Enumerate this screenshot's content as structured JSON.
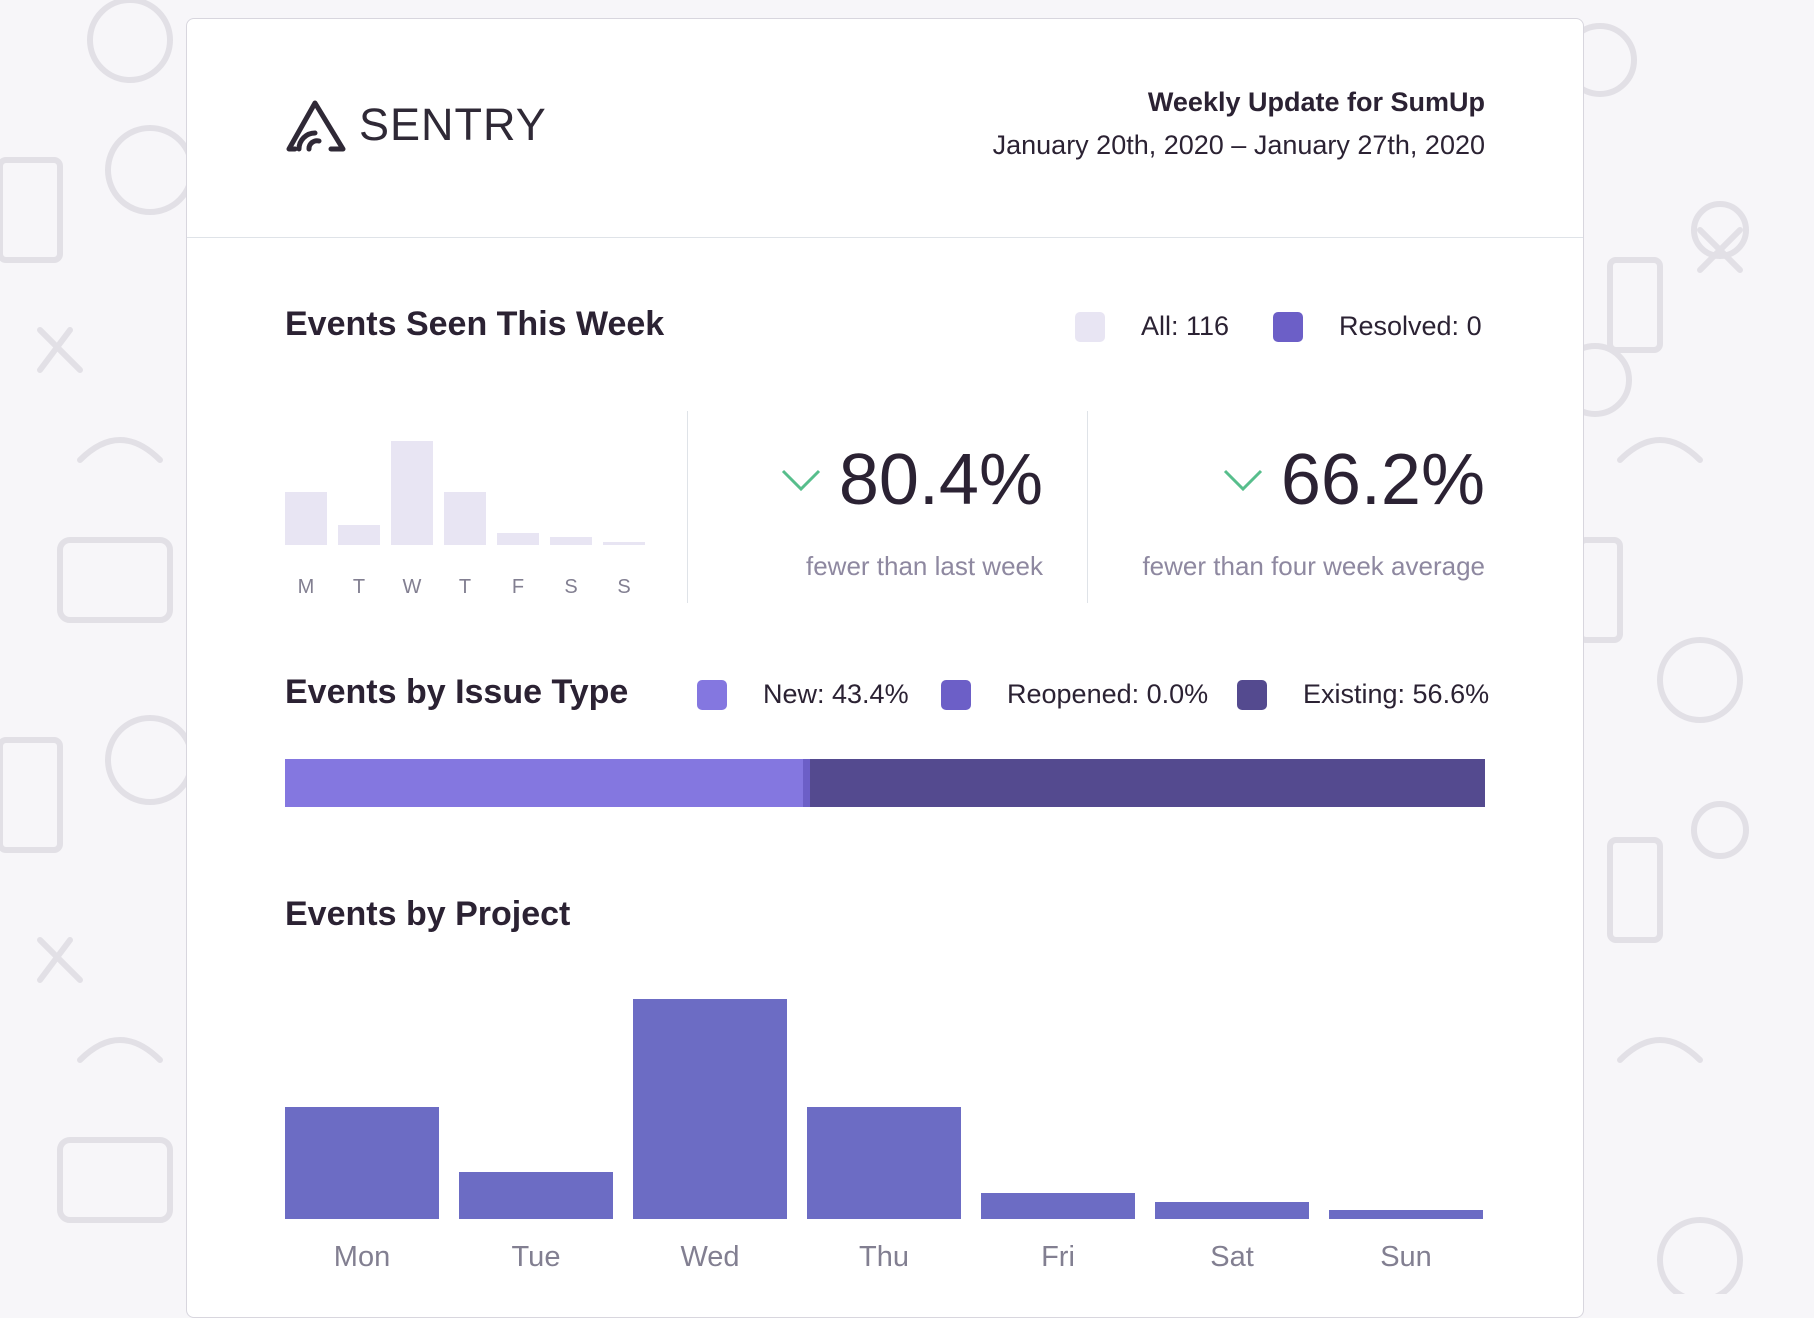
{
  "header": {
    "logo_text": "SENTRY",
    "title": "Weekly Update for SumUp",
    "dates": "January 20th, 2020 – January 27th, 2020"
  },
  "events_week": {
    "title": "Events Seen This Week",
    "legend": [
      {
        "label": "All: 116",
        "color": "#e8e5f3"
      },
      {
        "label": "Resolved: 0",
        "color": "#6c5fc7"
      }
    ],
    "day_labels": [
      "M",
      "T",
      "W",
      "T",
      "F",
      "S",
      "S"
    ],
    "values": [
      26,
      10,
      51,
      26,
      6,
      4,
      1
    ],
    "stats": [
      {
        "value": "80.4%",
        "caption": "fewer than last week"
      },
      {
        "value": "66.2%",
        "caption": "fewer than four week average"
      }
    ],
    "arrow_color": "#57be8c"
  },
  "issue_type": {
    "title": "Events by Issue Type",
    "legend": [
      {
        "label": "New: 43.4%",
        "color": "#8477e0"
      },
      {
        "label": "Reopened: 0.0%",
        "color": "#6c5fc7"
      },
      {
        "label": "Existing: 56.6%",
        "color": "#544a8f"
      }
    ],
    "percentages": [
      43.4,
      0.0,
      56.6
    ]
  },
  "by_project": {
    "title": "Events by Project",
    "color": "#6c6cc4",
    "chart_data": {
      "type": "bar",
      "categories": [
        "Mon",
        "Tue",
        "Wed",
        "Thu",
        "Fri",
        "Sat",
        "Sun"
      ],
      "values": [
        26,
        11,
        51,
        26,
        6,
        4,
        2
      ]
    }
  }
}
